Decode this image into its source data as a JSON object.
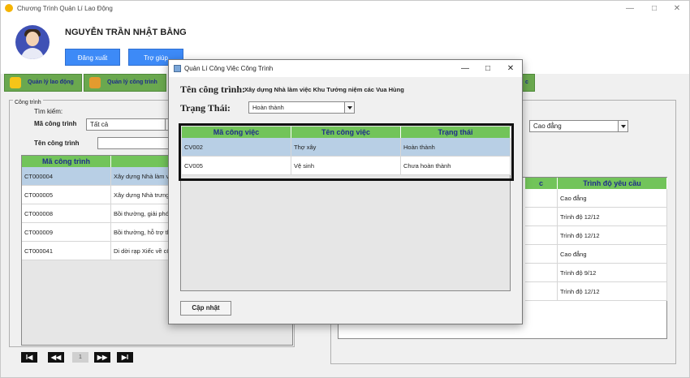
{
  "app": {
    "title": "Chương Trình Quản Lí Lao Động"
  },
  "user": {
    "name": "NGUYỄN TRẦN NHẬT BẰNG",
    "logout_label": "Đăng xuất",
    "help_label": "Trợ giúp"
  },
  "tabs": [
    {
      "label": "Quản lý lao động"
    },
    {
      "label": "Quản lý công trình"
    }
  ],
  "left_panel": {
    "group_title": "Công trình",
    "search_label": "Tìm kiếm:",
    "ma_label": "Mã công trình",
    "ma_value": "Tất cả",
    "ten_label": "Tên công trình",
    "columns": [
      "Mã công trình",
      "Tên công"
    ],
    "rows": [
      [
        "CT000004",
        "Xây dựng Nhà làm v"
      ],
      [
        "CT000005",
        "Xây dựng Nhà trưng"
      ],
      [
        "CT000008",
        "Bồi thường, giải phó"
      ],
      [
        "CT000009",
        "Bồi thường, hỗ trợ th"
      ],
      [
        "CT000041",
        "Di dời rạp Xiếc về cô"
      ]
    ],
    "page": "1"
  },
  "right_panel": {
    "combo_value": "Cao đẳng",
    "columns": [
      "c",
      "Trình độ yêu cầu"
    ],
    "rows": [
      "Cao đẳng",
      "Trình độ 12/12",
      "Trình độ 12/12",
      "Cao đẳng",
      "Trình độ 9/12",
      "Trình độ 12/12"
    ]
  },
  "dialog": {
    "title": "Quản Lí Công Việc Công Trình",
    "ten_label": "Tên công trình:",
    "ten_value": "Xây dựng Nhà làm việc Khu Tưởng niệm các Vua Hùng",
    "status_label": "Trạng Thái:",
    "status_value": "Hoàn thành",
    "columns": [
      "Mã công việc",
      "Tên công việc",
      "Trạng thái"
    ],
    "rows": [
      [
        "CV002",
        "Thợ xây",
        "Hoàn thành"
      ],
      [
        "CV005",
        "Vệ sinh",
        "Chưa hoàn thành"
      ]
    ],
    "update_label": "Cập nhật"
  }
}
